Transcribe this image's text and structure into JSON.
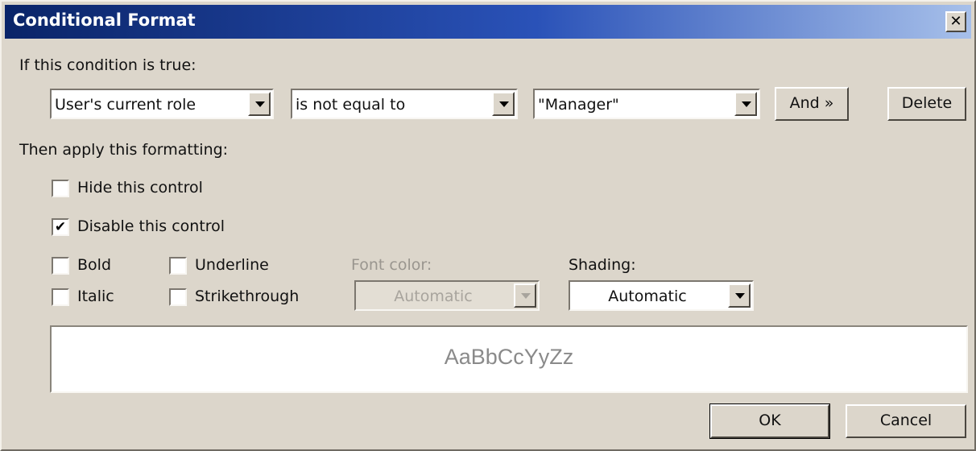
{
  "dialog": {
    "title": "Conditional Format"
  },
  "condition": {
    "heading": "If this condition is true:",
    "field": "User's current role",
    "operator": "is not equal to",
    "value": "\"Manager\"",
    "and_label": "And »",
    "delete_label": "Delete"
  },
  "formatting": {
    "heading": "Then apply this formatting:",
    "hide_label": "Hide this control",
    "hide_checked": false,
    "disable_label": "Disable this control",
    "disable_checked": true,
    "bold_label": "Bold",
    "italic_label": "Italic",
    "underline_label": "Underline",
    "strikethrough_label": "Strikethrough",
    "font_color_label": "Font color:",
    "font_color_value": "Automatic",
    "shading_label": "Shading:",
    "shading_value": "Automatic",
    "preview_text": "AaBbCcYyZz"
  },
  "buttons": {
    "ok": "OK",
    "cancel": "Cancel"
  },
  "icons": {
    "close": "close-icon",
    "dropdown": "chevron-down-icon",
    "checkmark": "checkmark-icon"
  },
  "colors": {
    "titlebar_start": "#0a2468",
    "titlebar_end": "#a7c0ea",
    "face": "#dcd6cb"
  }
}
